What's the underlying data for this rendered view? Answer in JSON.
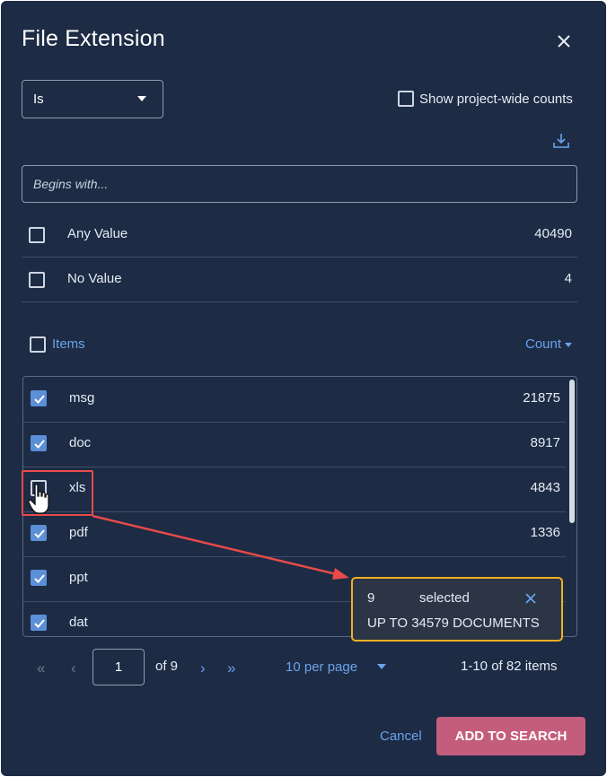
{
  "dialog": {
    "title": "File Extension"
  },
  "operator_select": {
    "value": "Is"
  },
  "project_wide": {
    "label": "Show project-wide counts",
    "checked": false
  },
  "search": {
    "placeholder": "Begins with...",
    "value": ""
  },
  "special_values": [
    {
      "label": "Any Value",
      "count": "40490",
      "checked": false
    },
    {
      "label": "No Value",
      "count": "4",
      "checked": false
    }
  ],
  "list_header": {
    "items_label": "Items",
    "count_label": "Count"
  },
  "items": [
    {
      "label": "msg",
      "count": "21875",
      "checked": true
    },
    {
      "label": "doc",
      "count": "8917",
      "checked": true
    },
    {
      "label": "xls",
      "count": "4843",
      "checked": false
    },
    {
      "label": "pdf",
      "count": "1336",
      "checked": true
    },
    {
      "label": "ppt",
      "count": "",
      "checked": true
    },
    {
      "label": "dat",
      "count": "",
      "checked": true
    }
  ],
  "pagination": {
    "page": "1",
    "of_pages": "of 9",
    "per_page": "10 per page",
    "range": "1-10 of 82 items"
  },
  "selection_popup": {
    "count": "9",
    "selected_label": "selected",
    "documents": "UP TO 34579 DOCUMENTS"
  },
  "footer": {
    "cancel_label": "Cancel",
    "add_label": "ADD TO SEARCH"
  },
  "colors": {
    "background": "#1d2b45",
    "accent": "#6aa3ea",
    "checkbox_checked": "#5b8fd6",
    "primary_button": "#c45d7d",
    "popup_border": "#f0b021",
    "annotation": "#e84a4a"
  },
  "icons": {
    "close": "close-icon",
    "download": "download-icon",
    "caret": "caret-down-icon",
    "first": "double-chevron-left-icon",
    "prev": "chevron-left-icon",
    "next": "chevron-right-icon",
    "last": "double-chevron-right-icon",
    "cursor": "hand-pointer-icon"
  }
}
